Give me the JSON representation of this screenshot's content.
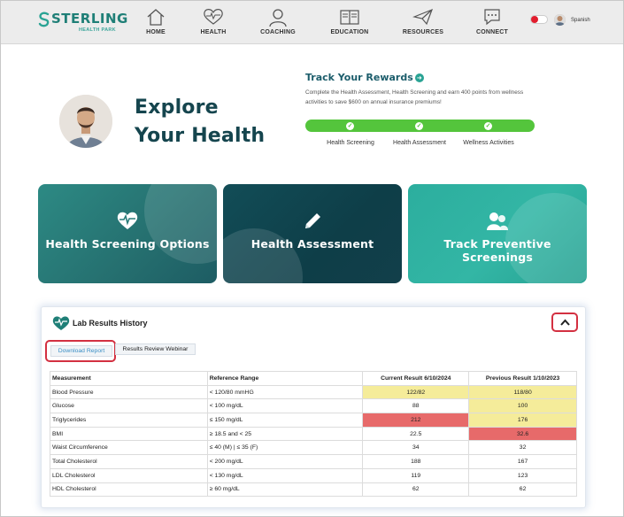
{
  "brand": {
    "name": "STERLING",
    "sub": "HEALTH PARK"
  },
  "nav": {
    "items": [
      {
        "label": "HOME",
        "icon": "home-icon"
      },
      {
        "label": "HEALTH",
        "icon": "heart-pulse-icon"
      },
      {
        "label": "COACHING",
        "icon": "person-icon"
      },
      {
        "label": "EDUCATION",
        "icon": "book-icon"
      },
      {
        "label": "RESOURCES",
        "icon": "paper-plane-icon"
      },
      {
        "label": "CONNECT",
        "icon": "chat-icon"
      }
    ],
    "language_label": "Spanish"
  },
  "hero": {
    "title_line1": "Explore",
    "title_line2": "Your Health"
  },
  "rewards": {
    "title": "Track Your Rewards",
    "description": "Complete the Health Assessment, Health Screening and earn 400 points from wellness activities to save $600 on annual insurance premiums!",
    "steps": [
      {
        "label": "Health Screening",
        "done": true
      },
      {
        "label": "Health Assessment",
        "done": true
      },
      {
        "label": "Wellness Activities",
        "done": true
      }
    ]
  },
  "cards": [
    {
      "label": "Health Screening Options",
      "icon": "heart-pulse-icon"
    },
    {
      "label": "Health Assessment",
      "icon": "pencil-icon"
    },
    {
      "label": "Track Preventive Screenings",
      "icon": "people-icon"
    }
  ],
  "lab": {
    "title": "Lab Results History",
    "tabs": {
      "download": "Download Report",
      "webinar": "Results Review Webinar"
    },
    "columns": [
      "Measurement",
      "Reference Range",
      "Current Result 6/10/2024",
      "Previous Result 1/10/2023"
    ],
    "rows": [
      {
        "measurement": "Blood Pressure",
        "range": "< 120/80 mmHG",
        "current": "122/82",
        "previous": "118/80",
        "current_status": "yellow",
        "previous_status": "yellow"
      },
      {
        "measurement": "Glucose",
        "range": "< 100 mg/dL",
        "current": "88",
        "previous": "100",
        "current_status": "normal",
        "previous_status": "yellow"
      },
      {
        "measurement": "Triglycerides",
        "range": "≤ 150 mg/dL",
        "current": "212",
        "previous": "176",
        "current_status": "red",
        "previous_status": "yellow"
      },
      {
        "measurement": "BMI",
        "range": "≥ 18.5 and < 25",
        "current": "22.5",
        "previous": "32.6",
        "current_status": "normal",
        "previous_status": "red"
      },
      {
        "measurement": "Waist Circumference",
        "range": "≤ 40 (M) | ≤ 35 (F)",
        "current": "34",
        "previous": "32",
        "current_status": "normal",
        "previous_status": "normal"
      },
      {
        "measurement": "Total Cholesterol",
        "range": "< 200 mg/dL",
        "current": "188",
        "previous": "167",
        "current_status": "normal",
        "previous_status": "normal"
      },
      {
        "measurement": "LDL Cholesterol",
        "range": "< 130 mg/dL",
        "current": "119",
        "previous": "123",
        "current_status": "normal",
        "previous_status": "normal"
      },
      {
        "measurement": "HDL Cholesterol",
        "range": "≥ 60 mg/dL",
        "current": "62",
        "previous": "62",
        "current_status": "normal",
        "previous_status": "normal"
      }
    ]
  },
  "colors": {
    "brand_teal": "#1f7f77",
    "dark_teal": "#15454e",
    "progress_green": "#54c53c",
    "alert_yellow": "#f5ec9a",
    "alert_red": "#e76a6a",
    "highlight_red": "#d33041"
  }
}
